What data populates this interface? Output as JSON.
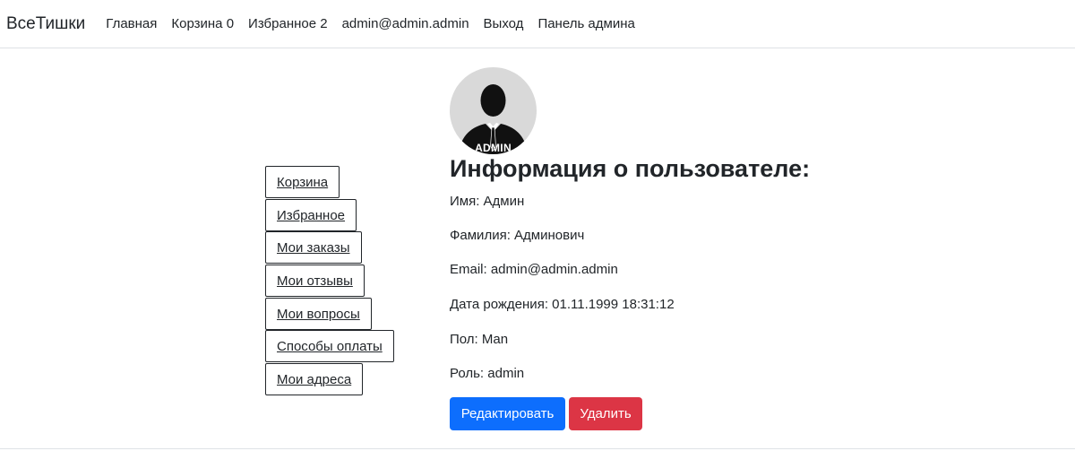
{
  "navbar": {
    "brand": "ВсеТишки",
    "links": [
      {
        "label": "Главная"
      },
      {
        "label": "Корзина 0"
      },
      {
        "label": "Избранное 2"
      },
      {
        "label": "admin@admin.admin"
      },
      {
        "label": "Выход"
      },
      {
        "label": "Панель админа"
      }
    ]
  },
  "side_menu": [
    {
      "label": "Корзина"
    },
    {
      "label": "Избранное"
    },
    {
      "label": "Мои заказы"
    },
    {
      "label": "Мои отзывы"
    },
    {
      "label": "Мои вопросы"
    },
    {
      "label": "Способы оплаты"
    },
    {
      "label": "Мои адреса"
    }
  ],
  "avatar": {
    "label": "ADMIN",
    "icon": "user-silhouette-icon"
  },
  "profile": {
    "title": "Информация о пользователе:",
    "rows": [
      {
        "text": "Имя: Админ"
      },
      {
        "text": "Фамилия: Админович"
      },
      {
        "text": "Email: admin@admin.admin"
      },
      {
        "text": "Дата рождения: 01.11.1999 18:31:12"
      },
      {
        "text": "Пол: Man"
      },
      {
        "text": "Роль: admin"
      }
    ]
  },
  "actions": {
    "edit_label": "Редактировать",
    "delete_label": "Удалить"
  },
  "colors": {
    "primary": "#0d6efd",
    "danger": "#dc3545",
    "text": "#212529",
    "border": "#dee2e6"
  }
}
